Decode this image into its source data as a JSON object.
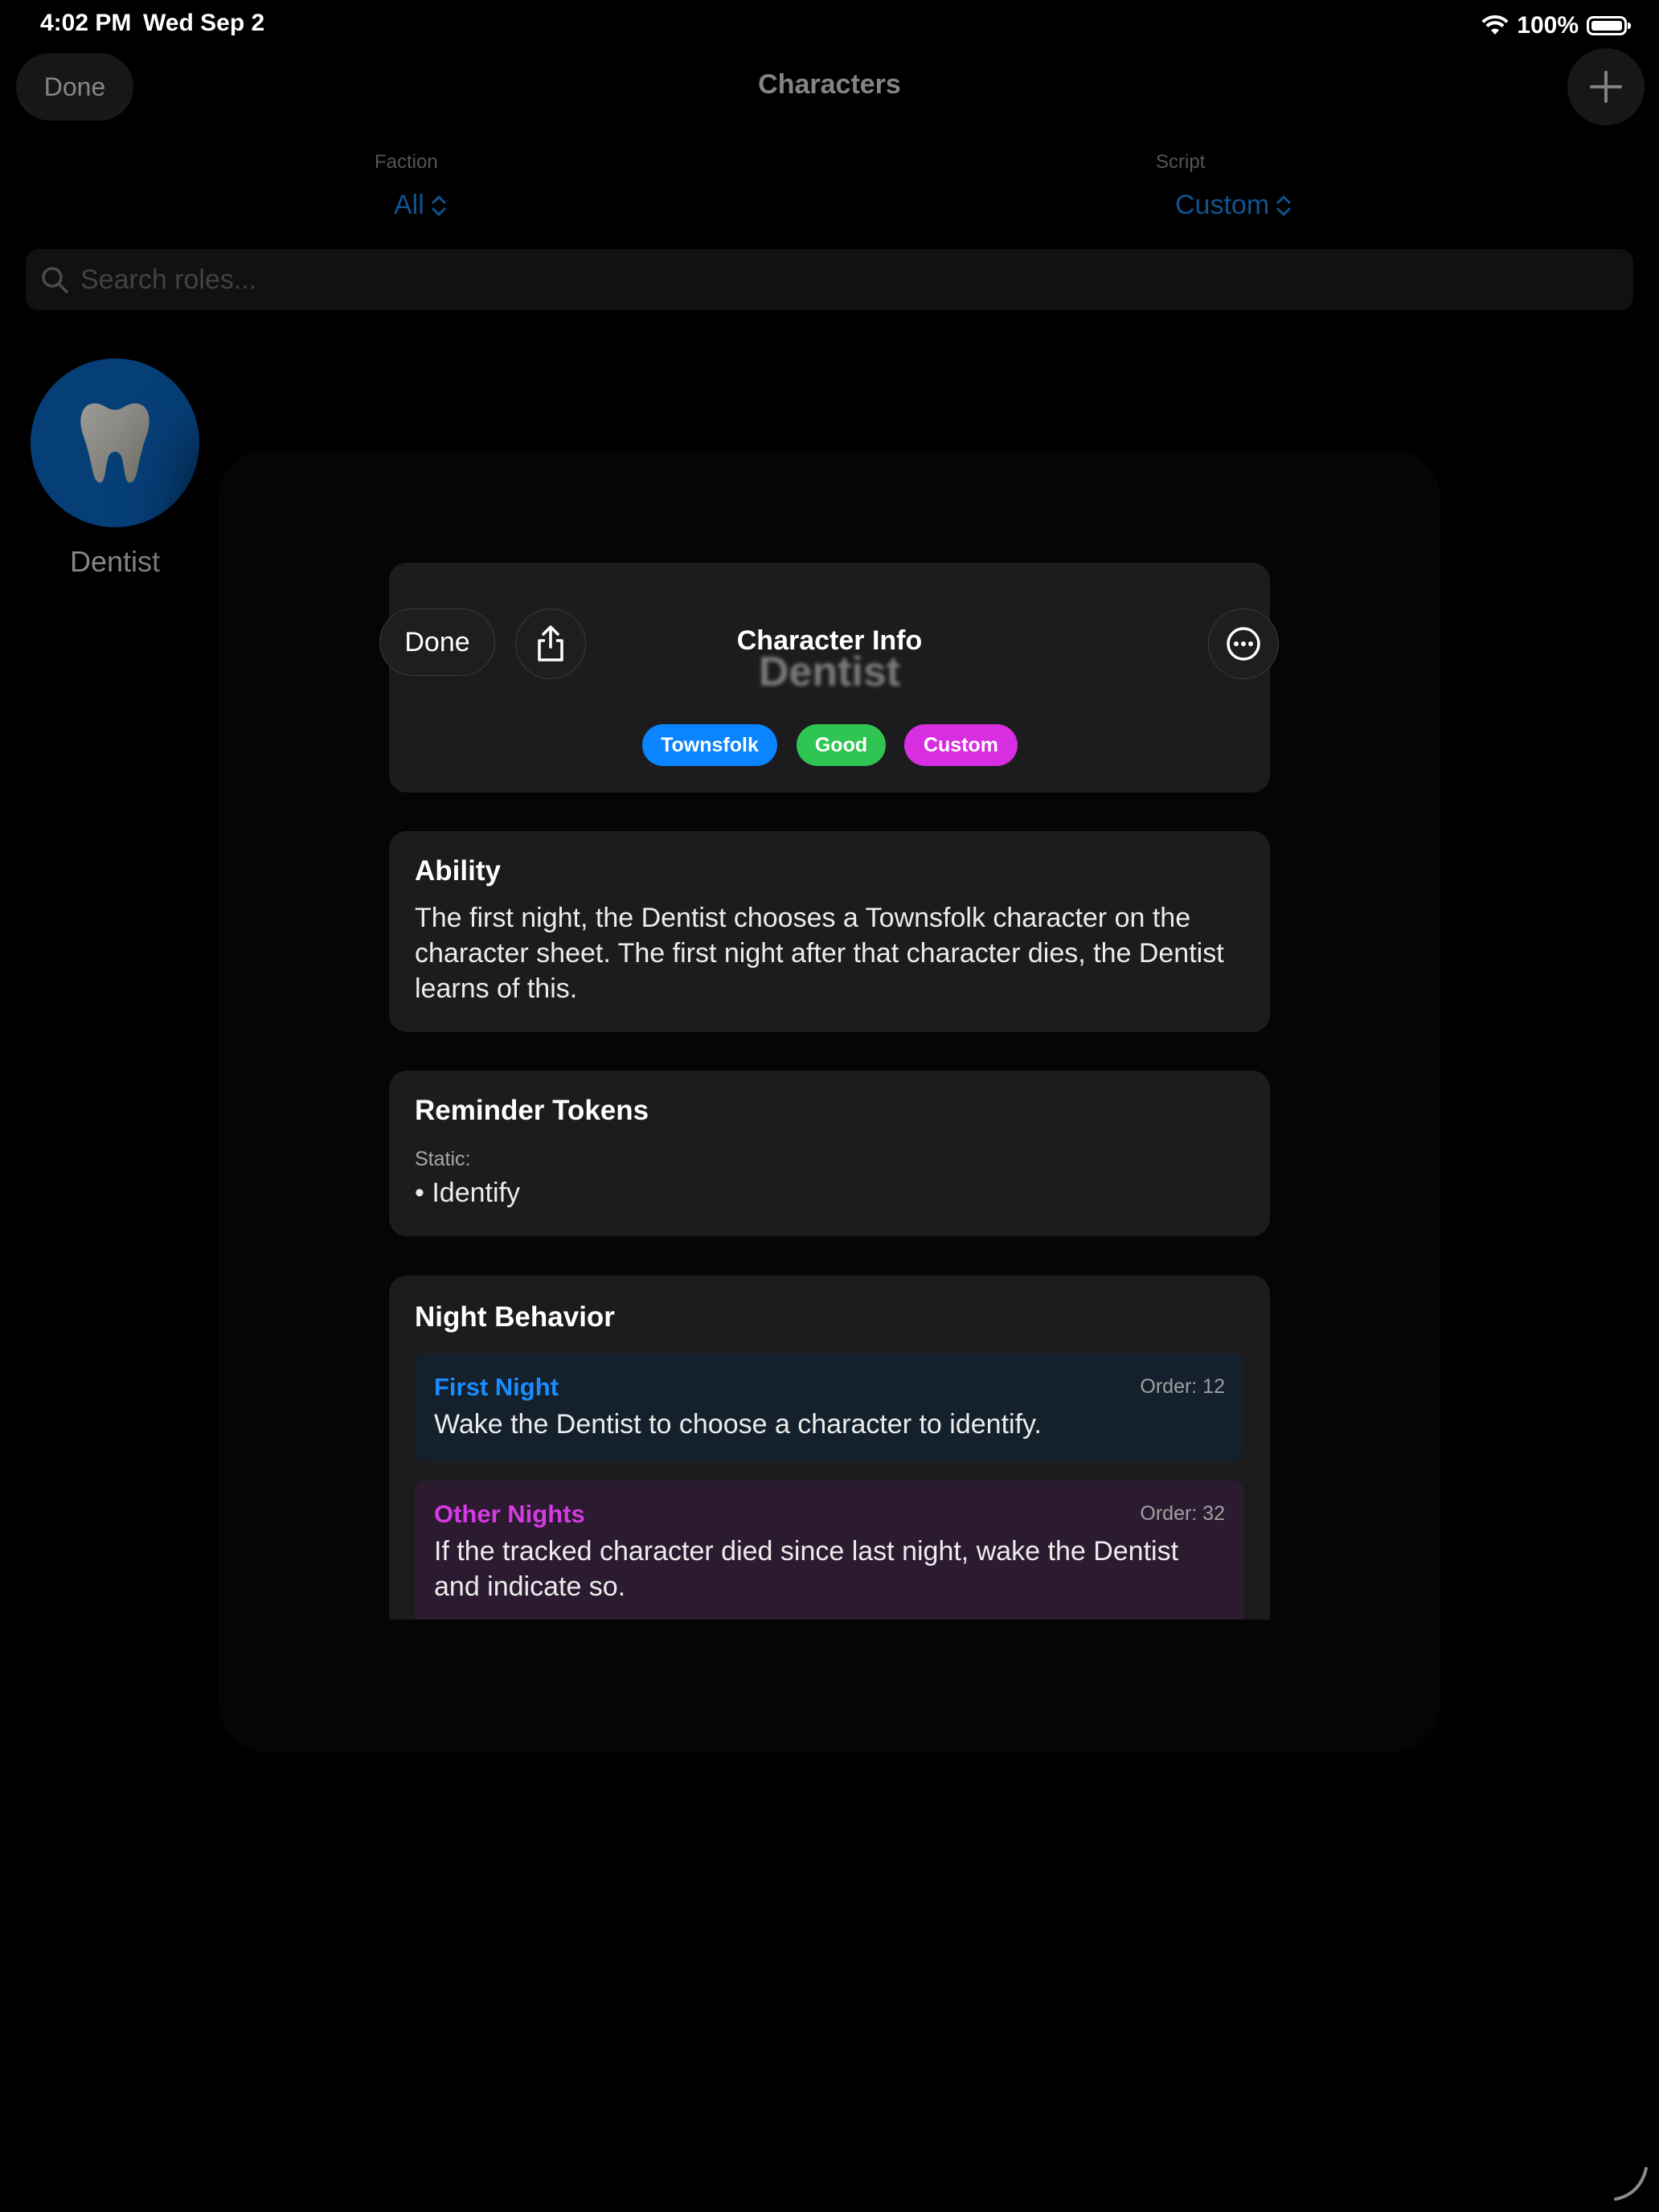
{
  "status_bar": {
    "time": "4:02 PM",
    "date": "Wed Sep 2",
    "battery": "100%"
  },
  "background": {
    "done_label": "Done",
    "title": "Characters",
    "faction": {
      "label": "Faction",
      "value": "All"
    },
    "script": {
      "label": "Script",
      "value": "Custom"
    },
    "search_placeholder": "Search roles...",
    "characters": [
      {
        "name": "Dentist",
        "icon": "tooth-icon",
        "color": "#0a66c2"
      }
    ]
  },
  "modal": {
    "done_label": "Done",
    "title": "Character Info",
    "character_name": "Dentist",
    "tags": [
      {
        "label": "Townsfolk",
        "color": "#0a84ff"
      },
      {
        "label": "Good",
        "color": "#30c552"
      },
      {
        "label": "Custom",
        "color": "#d62ee0"
      }
    ],
    "ability": {
      "title": "Ability",
      "text": "The first night, the Dentist chooses a Townsfolk character on the character sheet. The first night after that character dies, the Dentist learns of this."
    },
    "reminder_tokens": {
      "title": "Reminder Tokens",
      "static_label": "Static:",
      "items": [
        "• Identify"
      ]
    },
    "night_behavior": {
      "title": "Night Behavior",
      "first_night": {
        "label": "First Night",
        "order": "Order: 12",
        "text": "Wake the Dentist to choose a character to identify.",
        "color": "#1a8cff"
      },
      "other_nights": {
        "label": "Other Nights",
        "order": "Order: 32",
        "text": "If the tracked character died since last night, wake the Dentist and indicate so.",
        "color": "#d43be0"
      }
    }
  }
}
